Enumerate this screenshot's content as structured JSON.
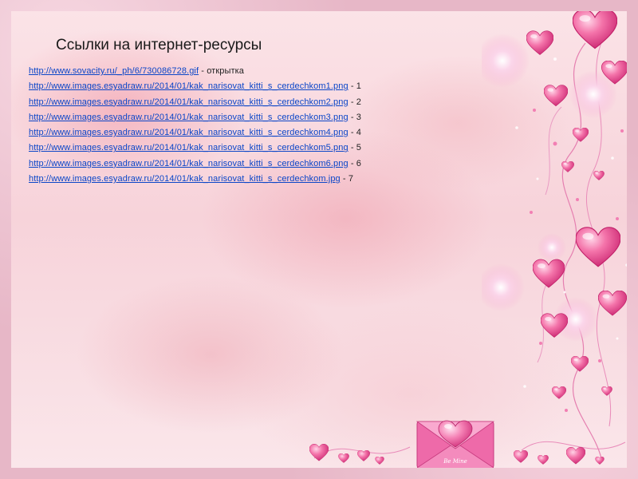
{
  "slide": {
    "title": "Ссылки на интернет-ресурсы",
    "links": [
      {
        "url": "http://www.sovacity.ru/_ph/6/730086728.gif",
        "desc": "открытка"
      },
      {
        "url": "http://www.images.esyadraw.ru/2014/01/kak_narisovat_kitti_s_cerdechkom1.png",
        "desc": "1"
      },
      {
        "url": "http://www.images.esyadraw.ru/2014/01/kak_narisovat_kitti_s_cerdechkom2.png",
        "desc": "2"
      },
      {
        "url": "http://www.images.esyadraw.ru/2014/01/kak_narisovat_kitti_s_cerdechkom3.png",
        "desc": "3"
      },
      {
        "url": "http://www.images.esyadraw.ru/2014/01/kak_narisovat_kitti_s_cerdechkom4.png",
        "desc": "4"
      },
      {
        "url": "http://www.images.esyadraw.ru/2014/01/kak_narisovat_kitti_s_cerdechkom5.png",
        "desc": "5"
      },
      {
        "url": "http://www.images.esyadraw.ru/2014/01/kak_narisovat_kitti_s_cerdechkom6.png",
        "desc": "6"
      },
      {
        "url": "http://www.images.esyadraw.ru/2014/01/kak_narisovat_kitti_s_cerdechkom.jpg",
        "desc": "7"
      }
    ],
    "separator": " - ",
    "envelope_text": "Be Mine"
  },
  "colors": {
    "link": "#0b46c8",
    "heart": "#f05a9a",
    "background": "#f7d3da"
  }
}
